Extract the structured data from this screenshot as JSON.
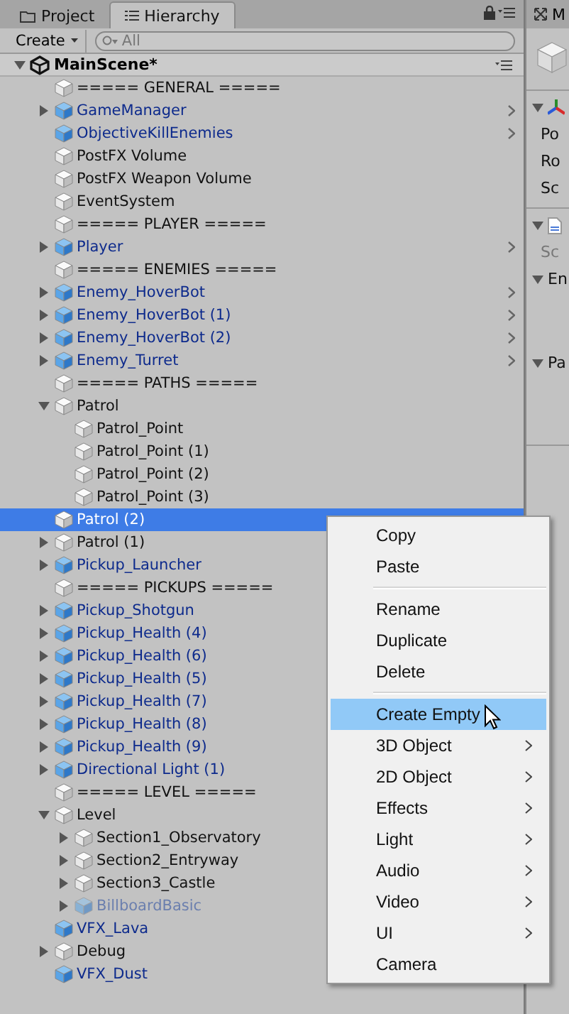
{
  "tabs": [
    {
      "label": "Project",
      "selected": false
    },
    {
      "label": "Hierarchy",
      "selected": true
    }
  ],
  "toolbar": {
    "create_label": "Create",
    "search_placeholder": "All"
  },
  "scene": {
    "name": "MainScene*",
    "expanded": true
  },
  "tree": [
    {
      "name": "===== GENERAL =====",
      "kind": "object"
    },
    {
      "name": "GameManager",
      "kind": "prefab",
      "expanded": false,
      "chevron": true
    },
    {
      "name": "ObjectiveKillEnemies",
      "kind": "prefab",
      "chevron": true
    },
    {
      "name": "PostFX Volume",
      "kind": "object"
    },
    {
      "name": "PostFX Weapon Volume",
      "kind": "object"
    },
    {
      "name": "EventSystem",
      "kind": "object"
    },
    {
      "name": "===== PLAYER =====",
      "kind": "object"
    },
    {
      "name": "Player",
      "kind": "prefab",
      "expanded": false,
      "chevron": true
    },
    {
      "name": "===== ENEMIES =====",
      "kind": "object"
    },
    {
      "name": "Enemy_HoverBot",
      "kind": "prefab",
      "expanded": false,
      "chevron": true
    },
    {
      "name": "Enemy_HoverBot (1)",
      "kind": "prefab",
      "expanded": false,
      "chevron": true
    },
    {
      "name": "Enemy_HoverBot (2)",
      "kind": "prefab",
      "expanded": false,
      "chevron": true
    },
    {
      "name": "Enemy_Turret",
      "kind": "prefab",
      "expanded": false,
      "chevron": true
    },
    {
      "name": "===== PATHS =====",
      "kind": "object"
    },
    {
      "name": "Patrol",
      "kind": "object",
      "expanded": true,
      "children": [
        {
          "name": "Patrol_Point",
          "kind": "object"
        },
        {
          "name": "Patrol_Point (1)",
          "kind": "object"
        },
        {
          "name": "Patrol_Point (2)",
          "kind": "object"
        },
        {
          "name": "Patrol_Point (3)",
          "kind": "object"
        }
      ]
    },
    {
      "name": "Patrol (2)",
      "kind": "object",
      "selected": true
    },
    {
      "name": "Patrol (1)",
      "kind": "object",
      "expanded": false
    },
    {
      "name": "Pickup_Launcher",
      "kind": "prefab",
      "expanded": false
    },
    {
      "name": "===== PICKUPS =====",
      "kind": "object"
    },
    {
      "name": "Pickup_Shotgun",
      "kind": "prefab",
      "expanded": false
    },
    {
      "name": "Pickup_Health (4)",
      "kind": "prefab",
      "expanded": false
    },
    {
      "name": "Pickup_Health (6)",
      "kind": "prefab",
      "expanded": false
    },
    {
      "name": "Pickup_Health (5)",
      "kind": "prefab",
      "expanded": false
    },
    {
      "name": "Pickup_Health (7)",
      "kind": "prefab",
      "expanded": false
    },
    {
      "name": "Pickup_Health (8)",
      "kind": "prefab",
      "expanded": false
    },
    {
      "name": "Pickup_Health (9)",
      "kind": "prefab",
      "expanded": false
    },
    {
      "name": "Directional Light (1)",
      "kind": "prefab",
      "expanded": false
    },
    {
      "name": "===== LEVEL =====",
      "kind": "object"
    },
    {
      "name": "Level",
      "kind": "object",
      "expanded": true,
      "children": [
        {
          "name": "Section1_Observatory",
          "kind": "object",
          "expanded": false
        },
        {
          "name": "Section2_Entryway",
          "kind": "object",
          "expanded": false
        },
        {
          "name": "Section3_Castle",
          "kind": "object",
          "expanded": false
        },
        {
          "name": "BillboardBasic",
          "kind": "prefab",
          "disabled": true,
          "expanded": false
        }
      ]
    },
    {
      "name": "VFX_Lava",
      "kind": "prefab"
    },
    {
      "name": "Debug",
      "kind": "object",
      "expanded": false
    },
    {
      "name": "VFX_Dust",
      "kind": "prefab"
    }
  ],
  "context_menu": [
    {
      "kind": "item",
      "label": "Copy"
    },
    {
      "kind": "item",
      "label": "Paste"
    },
    {
      "kind": "separator"
    },
    {
      "kind": "item",
      "label": "Rename"
    },
    {
      "kind": "item",
      "label": "Duplicate"
    },
    {
      "kind": "item",
      "label": "Delete"
    },
    {
      "kind": "separator"
    },
    {
      "kind": "item",
      "label": "Create Empty",
      "highlighted": true
    },
    {
      "kind": "submenu",
      "label": "3D Object"
    },
    {
      "kind": "submenu",
      "label": "2D Object"
    },
    {
      "kind": "submenu",
      "label": "Effects"
    },
    {
      "kind": "submenu",
      "label": "Light"
    },
    {
      "kind": "submenu",
      "label": "Audio"
    },
    {
      "kind": "submenu",
      "label": "Video"
    },
    {
      "kind": "submenu",
      "label": "UI"
    },
    {
      "kind": "item",
      "label": "Camera"
    }
  ],
  "inspector": {
    "tab_label": "M",
    "transform_labels": [
      "Po",
      "Ro",
      "Sc"
    ],
    "script_label": "Sc",
    "fields": [
      "En",
      "Pa"
    ]
  }
}
